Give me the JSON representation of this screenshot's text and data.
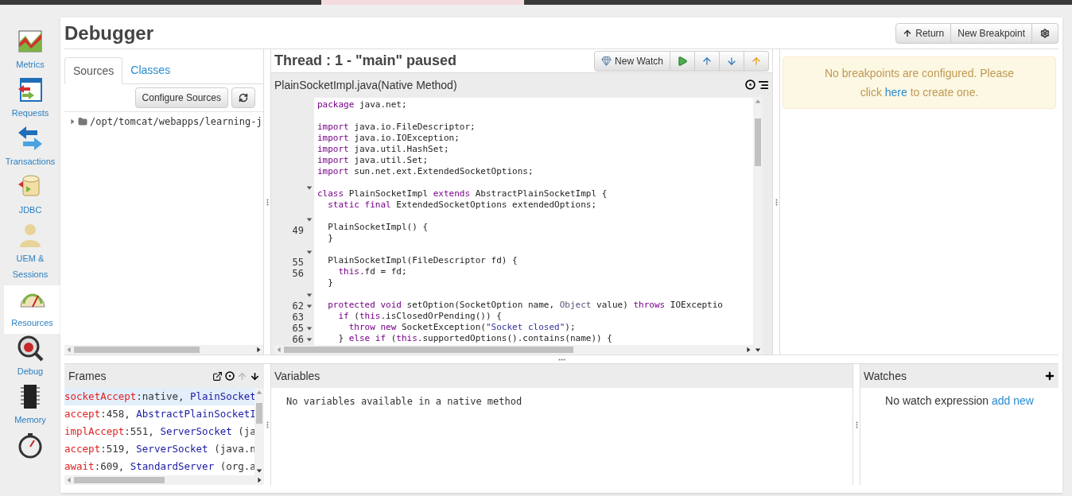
{
  "sidebar": {
    "items": [
      {
        "kind": "chart",
        "label": "Metrics",
        "selected": false
      },
      {
        "kind": "requests",
        "label": "Requests",
        "selected": false
      },
      {
        "kind": "transactions",
        "label": "Transactions",
        "selected": false
      },
      {
        "kind": "database",
        "label": "JDBC",
        "selected": false
      },
      {
        "kind": "user",
        "label": "UEM & Sessions",
        "selected": false
      },
      {
        "kind": "gauge",
        "label": "Resources",
        "selected": true
      },
      {
        "kind": "bug",
        "label": "Debug",
        "selected": false
      },
      {
        "kind": "chip",
        "label": "Memory",
        "selected": false
      },
      {
        "kind": "stopwatch",
        "selected": false
      }
    ]
  },
  "page": {
    "title": "Debugger",
    "buttons": [
      {
        "kind": "return",
        "label": "Return"
      },
      {
        "kind": "text",
        "label": "New Breakpoint"
      },
      {
        "kind": "settings"
      }
    ]
  },
  "sources": {
    "tabs": [
      {
        "label": "Sources",
        "selected": true
      },
      {
        "label": "Classes",
        "selected": false
      }
    ],
    "configure_button": "Configure Sources",
    "tree": [
      {
        "label": "/opt/tomcat/webapps/learning-j",
        "expanded": false
      }
    ]
  },
  "thread": {
    "title": "Thread : 1 - \"main\" paused",
    "new_watch": "New Watch",
    "file": "PlainSocketImpl.java(Native Method)",
    "lines": [
      {
        "fold": false,
        "tokens": [
          {
            "kind": "kw",
            "text": "package"
          },
          {
            "kind": "plain",
            "text": " java.net;"
          }
        ]
      },
      {
        "fold": false
      },
      {
        "fold": false,
        "tokens": [
          {
            "kind": "kw",
            "text": "import"
          },
          {
            "kind": "plain",
            "text": " java.io.FileDescriptor;"
          }
        ]
      },
      {
        "fold": false,
        "tokens": [
          {
            "kind": "kw",
            "text": "import"
          },
          {
            "kind": "plain",
            "text": " java.io.IOException;"
          }
        ]
      },
      {
        "fold": false,
        "tokens": [
          {
            "kind": "kw",
            "text": "import"
          },
          {
            "kind": "plain",
            "text": " java.util.HashSet;"
          }
        ]
      },
      {
        "fold": false,
        "tokens": [
          {
            "kind": "kw",
            "text": "import"
          },
          {
            "kind": "plain",
            "text": " java.util.Set;"
          }
        ]
      },
      {
        "fold": false,
        "tokens": [
          {
            "kind": "kw",
            "text": "import"
          },
          {
            "kind": "plain",
            "text": " sun.net.ext.ExtendedSocketOptions;"
          }
        ]
      },
      {
        "fold": false
      },
      {
        "fold": true,
        "tokens": [
          {
            "kind": "kw",
            "text": "class"
          },
          {
            "kind": "plain",
            "text": " PlainSocketImpl "
          },
          {
            "kind": "kw",
            "text": "extends"
          },
          {
            "kind": "plain",
            "text": " AbstractPlainSocketImpl {"
          }
        ]
      },
      {
        "fold": false,
        "tokens": [
          {
            "kind": "kw",
            "text": "  static final"
          },
          {
            "kind": "plain",
            "text": " ExtendedSocketOptions extendedOptions;"
          }
        ]
      },
      {
        "fold": false
      },
      {
        "fold": true,
        "tokens": [
          {
            "kind": "plain",
            "text": "  PlainSocketImpl() {"
          }
        ]
      },
      {
        "number": "49",
        "fold": false,
        "tokens": [
          {
            "kind": "plain",
            "text": "  }"
          }
        ]
      },
      {
        "fold": false
      },
      {
        "fold": true,
        "tokens": [
          {
            "kind": "plain",
            "text": "  PlainSocketImpl(FileDescriptor fd) {"
          }
        ]
      },
      {
        "number": "55",
        "fold": false,
        "tokens": [
          {
            "kind": "kw",
            "text": "    this"
          },
          {
            "kind": "plain",
            "text": ".fd = fd;"
          }
        ]
      },
      {
        "number": "56",
        "fold": false,
        "tokens": [
          {
            "kind": "plain",
            "text": "  }"
          }
        ]
      },
      {
        "fold": false
      },
      {
        "fold": true,
        "tokens": [
          {
            "kind": "kw",
            "text": "  protected void"
          },
          {
            "kind": "plain",
            "text": " setOption(SocketOption name, "
          },
          {
            "kind": "type",
            "text": "Object"
          },
          {
            "kind": "plain",
            "text": " value) "
          },
          {
            "kind": "kw",
            "text": "throws"
          },
          {
            "kind": "plain",
            "text": " IOExceptio"
          }
        ]
      },
      {
        "number": "62",
        "fold": true,
        "tokens": [
          {
            "kind": "kw",
            "text": "    if"
          },
          {
            "kind": "plain",
            "text": " ("
          },
          {
            "kind": "kw",
            "text": "this"
          },
          {
            "kind": "plain",
            "text": ".isClosedOrPending()) {"
          }
        ]
      },
      {
        "number": "63",
        "fold": false,
        "tokens": [
          {
            "kind": "kw",
            "text": "      throw new"
          },
          {
            "kind": "plain",
            "text": " SocketException("
          },
          {
            "kind": "str",
            "text": "\"Socket closed\""
          },
          {
            "kind": "plain",
            "text": ");"
          }
        ]
      },
      {
        "number": "65",
        "fold": true,
        "tokens": [
          {
            "kind": "plain",
            "text": "    } "
          },
          {
            "kind": "kw",
            "text": "else if"
          },
          {
            "kind": "plain",
            "text": " ("
          },
          {
            "kind": "kw",
            "text": "this"
          },
          {
            "kind": "plain",
            "text": ".supportedOptions().contains(name)) {"
          }
        ]
      },
      {
        "number": "66",
        "fold": true
      }
    ]
  },
  "breakpoints": {
    "message": "No breakpoints are configured. Please click",
    "link": "here",
    "message_end": "to create one."
  },
  "frames": {
    "title": "Frames",
    "rows": [
      {
        "selected": true,
        "method": "socketAccept",
        "location": ":native, ",
        "class": "PlainSocket"
      },
      {
        "selected": false,
        "method": "accept",
        "location": ":458, ",
        "class": "AbstractPlainSocketI"
      },
      {
        "selected": false,
        "method": "implAccept",
        "location": ":551, ",
        "class": "ServerSocket",
        "package": " (ja"
      },
      {
        "selected": false,
        "method": "accept",
        "location": ":519, ",
        "class": "ServerSocket",
        "package": " (java.n"
      },
      {
        "selected": false,
        "method": "await",
        "location": ":609, ",
        "class": "StandardServer",
        "package": " (org.a"
      }
    ]
  },
  "variables": {
    "title": "Variables",
    "message": "No variables available in a native method"
  },
  "watches": {
    "title": "Watches",
    "message": "No watch expression",
    "link": "add new"
  }
}
